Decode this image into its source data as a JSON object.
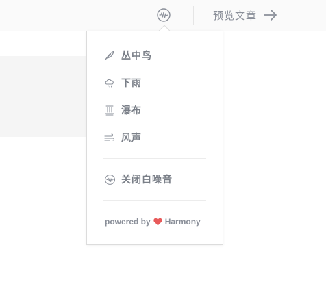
{
  "header": {
    "preview_label": "预览文章"
  },
  "menu": {
    "items": [
      {
        "label": "丛中鸟",
        "icon": "bird-icon"
      },
      {
        "label": "下雨",
        "icon": "rain-cloud-icon"
      },
      {
        "label": "瀑布",
        "icon": "waterfall-icon"
      },
      {
        "label": "风声",
        "icon": "wind-icon"
      }
    ],
    "close_label": "关闭白噪音",
    "powered_prefix": "powered by",
    "powered_brand": "Harmony"
  },
  "colors": {
    "text": "#7a7f88",
    "heart": "#e85a5a"
  }
}
